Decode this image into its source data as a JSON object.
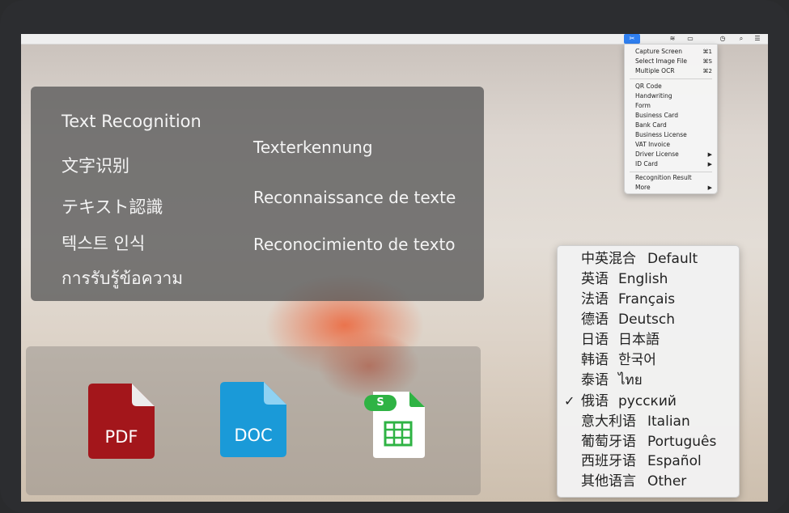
{
  "menubar": {
    "icons": [
      {
        "name": "app-logo-icon",
        "glyph": "✂"
      },
      {
        "name": "wifi-icon",
        "glyph": "≋"
      },
      {
        "name": "battery-icon",
        "glyph": "▭"
      },
      {
        "name": "clock-icon",
        "glyph": "◷"
      },
      {
        "name": "search-icon",
        "glyph": "⌕"
      },
      {
        "name": "list-icon",
        "glyph": "☰"
      }
    ]
  },
  "app_menu": {
    "capture": [
      {
        "label": "Capture Screen",
        "shortcut": "⌘1"
      },
      {
        "label": "Select Image File",
        "shortcut": "⌘S"
      },
      {
        "label": "Multiple OCR",
        "shortcut": "⌘2"
      }
    ],
    "types": [
      {
        "label": "QR Code",
        "shortcut": ""
      },
      {
        "label": "Handwriting",
        "shortcut": ""
      },
      {
        "label": "Form",
        "shortcut": ""
      },
      {
        "label": "Business Card",
        "shortcut": ""
      },
      {
        "label": "Bank Card",
        "shortcut": ""
      },
      {
        "label": "Business License",
        "shortcut": ""
      },
      {
        "label": "VAT Invoice",
        "shortcut": ""
      },
      {
        "label": "Driver License",
        "shortcut": "▶"
      },
      {
        "label": "ID Card",
        "shortcut": "▶"
      }
    ],
    "extra": [
      {
        "label": "Recognition Result",
        "shortcut": ""
      },
      {
        "label": "More",
        "shortcut": "▶"
      }
    ]
  },
  "ocr_panel": {
    "left": [
      "Text Recognition",
      "文字识别",
      "テキスト認識",
      "텍스트 인식",
      "การรับรู้ข้อความ"
    ],
    "right": [
      "Texterkennung",
      "Reconnaissance de texte",
      "Reconocimiento de texto"
    ]
  },
  "export": {
    "pdf_label": "PDF",
    "doc_label": "DOC",
    "sheet_badge": "S"
  },
  "language_menu": {
    "items": [
      {
        "cn": "中英混合",
        "native": "Default",
        "checked": false
      },
      {
        "cn": "英语",
        "native": "English",
        "checked": false
      },
      {
        "cn": "法语",
        "native": "Français",
        "checked": false
      },
      {
        "cn": "德语",
        "native": "Deutsch",
        "checked": false
      },
      {
        "cn": "日语",
        "native": "日本語",
        "checked": false
      },
      {
        "cn": "韩语",
        "native": "한국어",
        "checked": false
      },
      {
        "cn": "泰语",
        "native": "ไทย",
        "checked": false
      },
      {
        "cn": "俄语",
        "native": "русский",
        "checked": true
      },
      {
        "cn": "意大利语",
        "native": "Italian",
        "checked": false
      },
      {
        "cn": "葡萄牙语",
        "native": "Português",
        "checked": false
      },
      {
        "cn": "西班牙语",
        "native": "Español",
        "checked": false
      },
      {
        "cn": "其他语言",
        "native": "Other",
        "checked": false
      }
    ],
    "check_glyph": "✓"
  },
  "colors": {
    "accent": "#2f7ff0",
    "pdf": "#a3161b",
    "doc": "#1a9ad8",
    "sheet_green": "#2fb344"
  }
}
